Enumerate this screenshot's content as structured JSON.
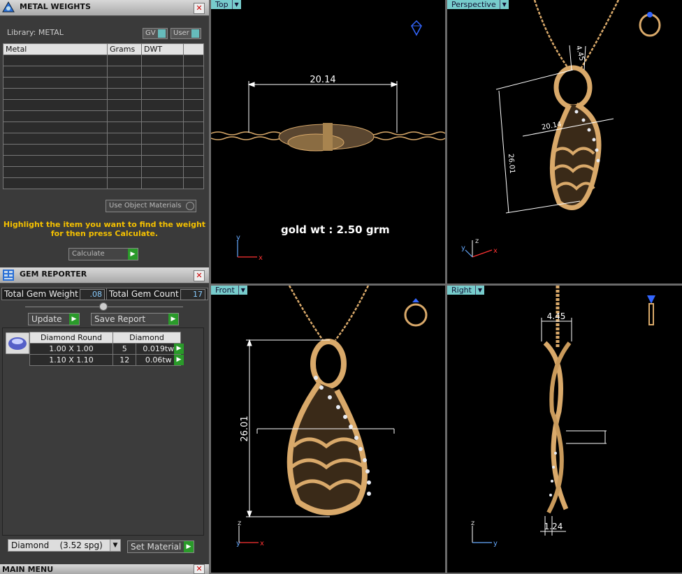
{
  "metal_weights": {
    "title": "METAL WEIGHTS",
    "library_label": "Library: METAL",
    "toggle_gv": "GV",
    "toggle_user": "User",
    "columns": [
      "Metal",
      "Grams",
      "DWT"
    ],
    "use_object_materials": "Use Object Materials",
    "message_line1": "Highlight the item you want to find the weight",
    "message_line2": "for then press Calculate.",
    "calculate_button": "Calculate"
  },
  "gem_reporter": {
    "title": "GEM REPORTER",
    "total_gem_weight_label": "Total Gem Weight",
    "total_gem_weight_value": ".08",
    "total_gem_count_label": "Total Gem Count",
    "total_gem_count_value": "17",
    "update_button": "Update",
    "save_report_button": "Save Report",
    "table_headers": [
      "Diamond Round",
      "Diamond"
    ],
    "rows": [
      {
        "size": "1.00 X 1.00",
        "count": "5",
        "weight": "0.019tw"
      },
      {
        "size": "1.10 X 1.10",
        "count": "12",
        "weight": "0.06tw"
      }
    ],
    "material_select": "Diamond    (3.52 spg)",
    "set_material_button": "Set Material"
  },
  "main_menu": {
    "title": "MAIN MENU"
  },
  "viewports": {
    "top": {
      "label": "Top",
      "dimension": "20.14",
      "annotation": "gold wt :  2.50 grm"
    },
    "perspective": {
      "label": "Perspective",
      "dim_a": "4.45",
      "dim_b": "20.14",
      "dim_c": "26.01"
    },
    "front": {
      "label": "Front",
      "dimension": "26.01"
    },
    "right": {
      "label": "Right",
      "dim_a": "4.45",
      "dim_b": "1.24"
    }
  },
  "colors": {
    "gold": "#d9a96a",
    "tab": "#77cccc",
    "accent_yellow": "#f4c000"
  }
}
